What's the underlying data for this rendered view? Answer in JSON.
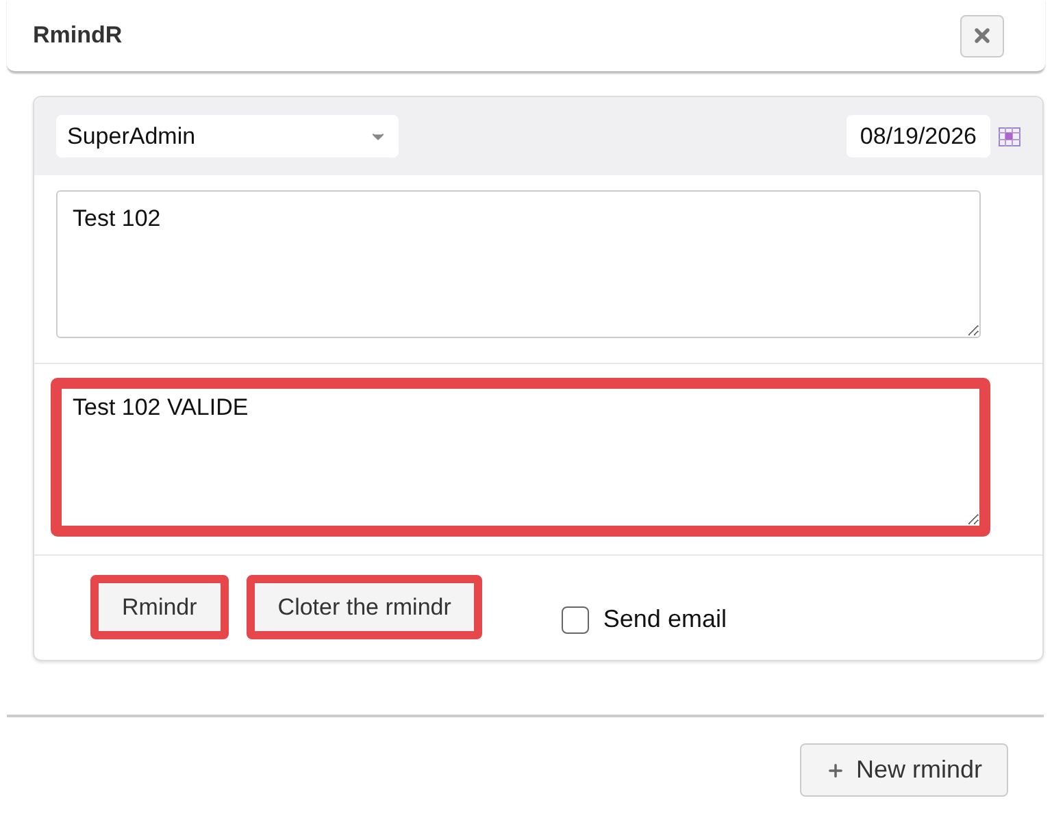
{
  "dialog": {
    "title": "RmindR"
  },
  "form": {
    "assignee": {
      "value": "SuperAdmin"
    },
    "date": {
      "value": "08/19/2026"
    },
    "notes": [
      {
        "value": "Test 102",
        "highlighted": false
      },
      {
        "value": "Test 102 VALIDE",
        "highlighted": true
      }
    ],
    "buttons": [
      {
        "label": "Rmindr",
        "highlighted": true
      },
      {
        "label": "Cloter the rmindr",
        "highlighted": true
      }
    ],
    "send_email": {
      "label": "Send email",
      "checked": false
    }
  },
  "footer": {
    "button": "New rmindr"
  }
}
